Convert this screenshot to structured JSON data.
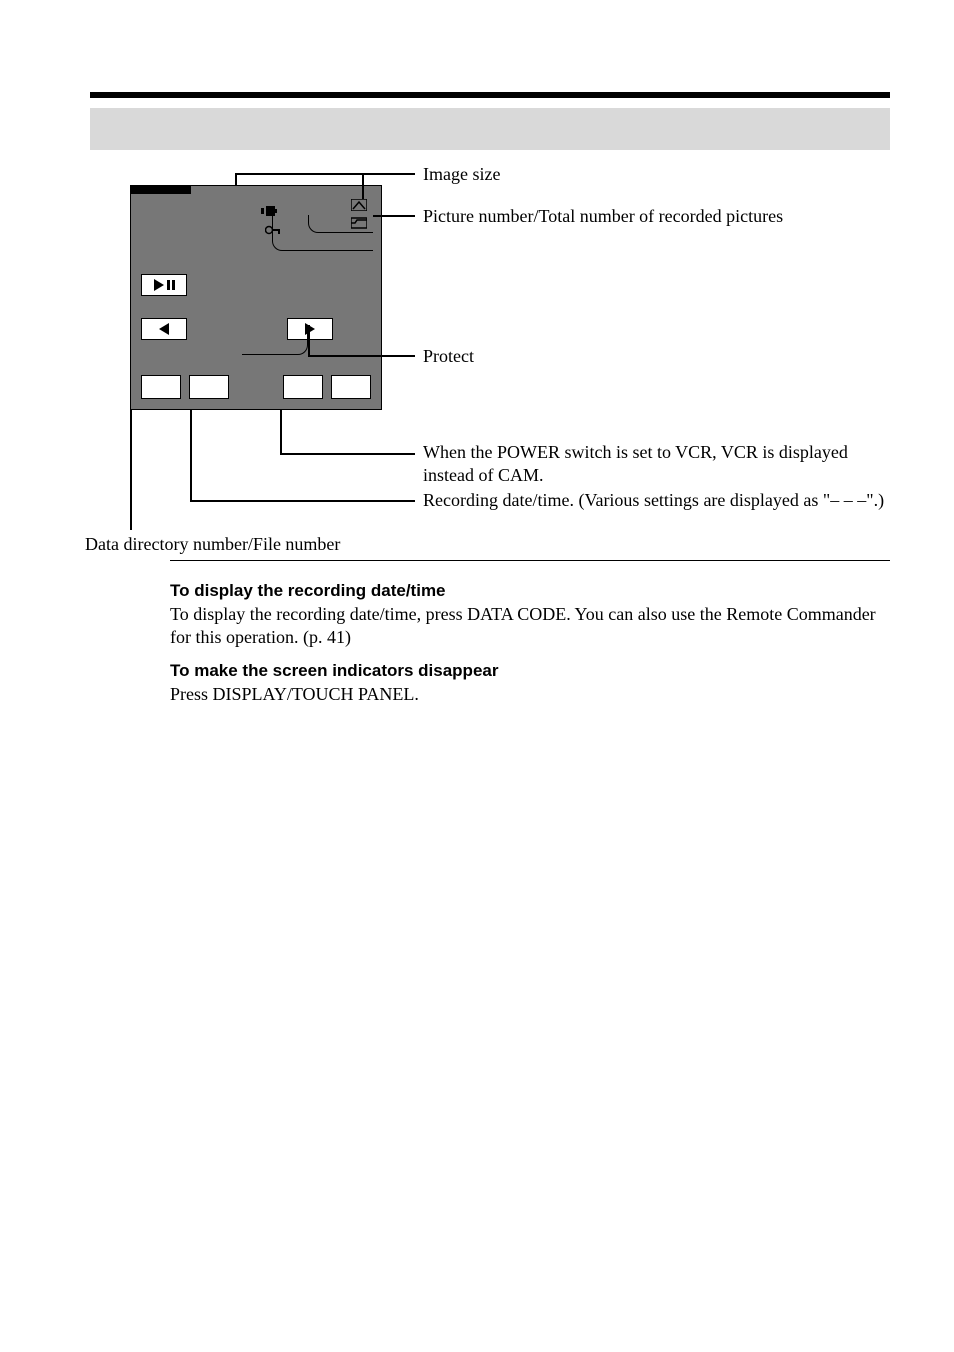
{
  "header": {
    "title": ""
  },
  "callouts": {
    "image_size": "Image size",
    "picture_number": "Picture number/Total number of recorded pictures",
    "protect": "Protect",
    "cam_vcr": "When the POWER switch is set to VCR, VCR is displayed instead of CAM.",
    "recording_date": "Recording date/time. (Various settings are displayed as \"– – –\".)",
    "data_directory": "Data directory number/File number"
  },
  "lcd": {
    "size": "",
    "count": "",
    "mode": "",
    "dir_file": "",
    "date": "",
    "protect_mark": ""
  },
  "body": {
    "recdate_heading": "To display the recording date/time",
    "recdate_text": "To display the recording date/time, press DATA CODE. You can also use the Remote Commander for this operation. (p. 41)",
    "hide_heading": "To make the screen indicators disappear",
    "hide_text": "Press DISPLAY/TOUCH PANEL."
  }
}
